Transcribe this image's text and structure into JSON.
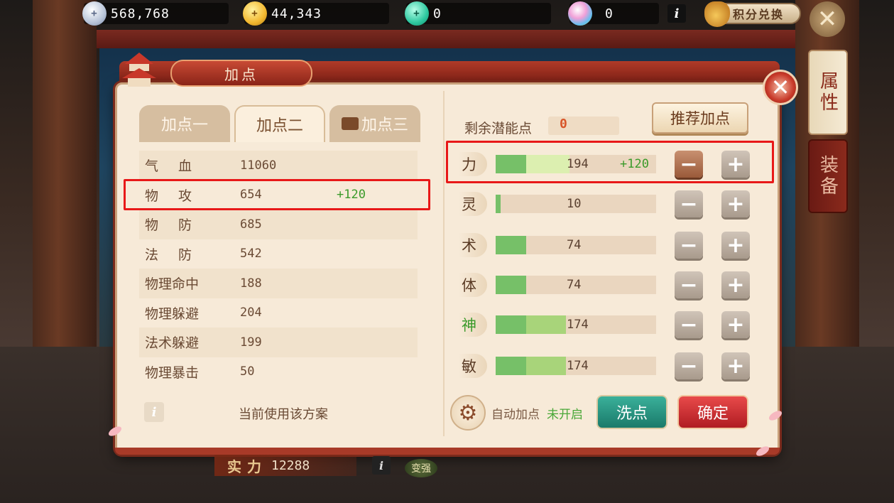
{
  "currencies": [
    {
      "icon": "silver-coin-icon",
      "value": "568,768"
    },
    {
      "icon": "gold-coin-icon",
      "value": "44,343"
    },
    {
      "icon": "jade-icon",
      "value": "0"
    },
    {
      "icon": "crystal-drop-icon",
      "value": "0"
    }
  ],
  "topbar": {
    "info": "i",
    "exchange_label": "积分兑换"
  },
  "side_tabs": [
    "属性",
    "装备"
  ],
  "panel": {
    "title": "加点"
  },
  "plan_tabs": [
    {
      "label": "加点一",
      "active": false
    },
    {
      "label": "加点二",
      "active": true
    },
    {
      "label": "加点三",
      "active": false
    }
  ],
  "stats": [
    {
      "label": "气血",
      "value": "11060",
      "bonus": ""
    },
    {
      "label": "物攻",
      "value": "654",
      "bonus": "+120"
    },
    {
      "label": "物防",
      "value": "685",
      "bonus": ""
    },
    {
      "label": "法防",
      "value": "542",
      "bonus": ""
    },
    {
      "label": "物理命中",
      "value": "188",
      "bonus": ""
    },
    {
      "label": "物理躲避",
      "value": "204",
      "bonus": ""
    },
    {
      "label": "法术躲避",
      "value": "199",
      "bonus": ""
    },
    {
      "label": "物理暴击",
      "value": "50",
      "bonus": ""
    }
  ],
  "plan_note": "当前使用该方案",
  "remaining": {
    "label": "剩余潜能点",
    "value": "0"
  },
  "recommend_label": "推荐加点",
  "attributes": [
    {
      "name": "力",
      "value": "194",
      "bonus": "+120",
      "base_fraction": 0.19,
      "extra_fraction": 0,
      "add_fraction": 0.27,
      "color": "#5a3a24"
    },
    {
      "name": "灵",
      "value": "10",
      "bonus": "",
      "base_fraction": 0.03,
      "extra_fraction": 0,
      "add_fraction": 0,
      "color": "#5a3a24"
    },
    {
      "name": "术",
      "value": "74",
      "bonus": "",
      "base_fraction": 0.19,
      "extra_fraction": 0,
      "add_fraction": 0,
      "color": "#5a3a24"
    },
    {
      "name": "体",
      "value": "74",
      "bonus": "",
      "base_fraction": 0.19,
      "extra_fraction": 0,
      "add_fraction": 0,
      "color": "#5a3a24"
    },
    {
      "name": "神",
      "value": "174",
      "bonus": "",
      "base_fraction": 0.19,
      "extra_fraction": 0.25,
      "add_fraction": 0,
      "color": "#3a9a2a"
    },
    {
      "name": "敏",
      "value": "174",
      "bonus": "",
      "base_fraction": 0.19,
      "extra_fraction": 0.25,
      "add_fraction": 0,
      "color": "#5a3a24"
    }
  ],
  "auto": {
    "label": "自动加点",
    "status": "未开启"
  },
  "buttons": {
    "wash": "洗点",
    "confirm": "确定",
    "minus": "−",
    "plus": "+"
  },
  "power": {
    "label": "实力",
    "value": "12288",
    "info": "i",
    "strengthen": "变强"
  },
  "colors": {
    "highlight": "#e81818",
    "bonus_green": "#3a9a2a",
    "confirm_red": "#c8242a",
    "wash_teal": "#2a9a88"
  }
}
